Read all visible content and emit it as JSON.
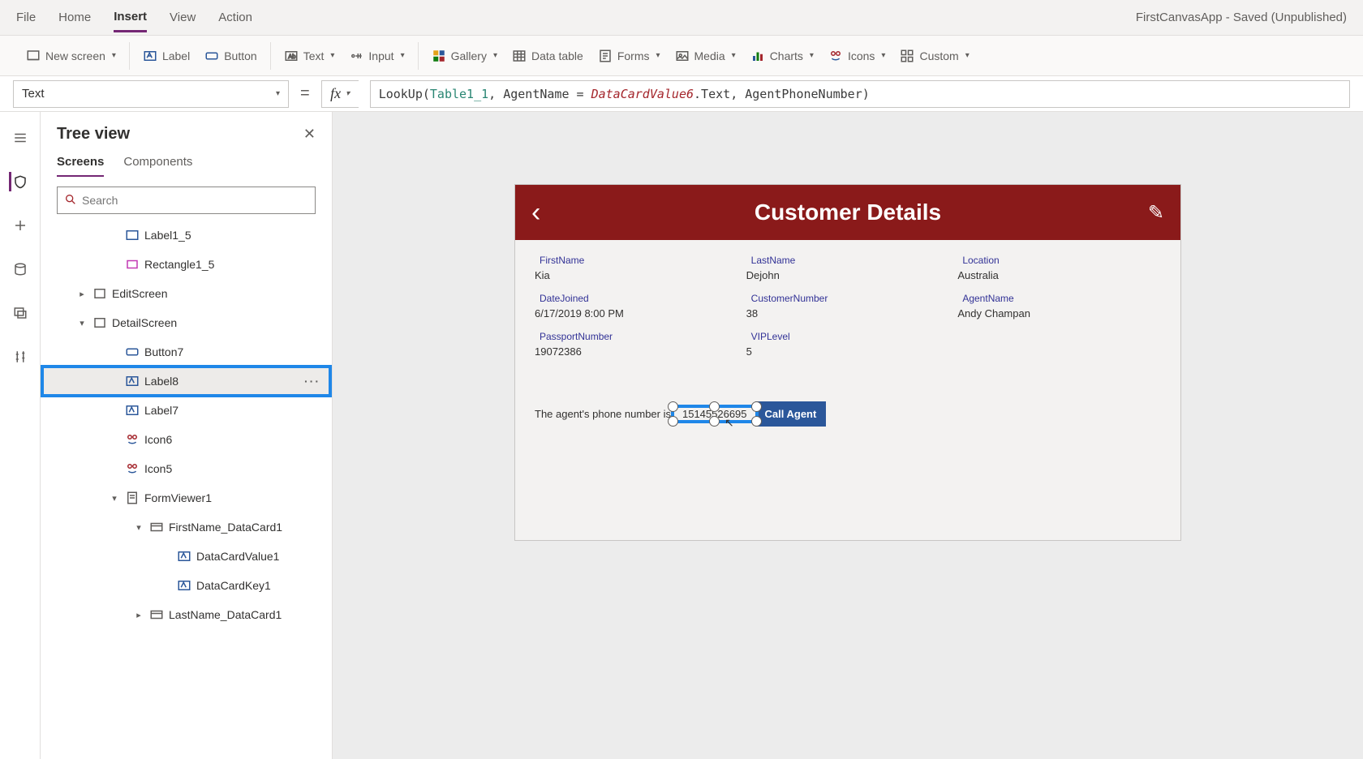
{
  "app_title": "FirstCanvasApp - Saved (Unpublished)",
  "menubar": [
    "File",
    "Home",
    "Insert",
    "View",
    "Action"
  ],
  "menubar_active": "Insert",
  "ribbon": {
    "new_screen": "New screen",
    "label": "Label",
    "button": "Button",
    "text": "Text",
    "input": "Input",
    "gallery": "Gallery",
    "data_table": "Data table",
    "forms": "Forms",
    "media": "Media",
    "charts": "Charts",
    "icons": "Icons",
    "custom": "Custom"
  },
  "formula": {
    "property": "Text",
    "fx": "fx",
    "tokens": {
      "fn": "LookUp",
      "arg1": "Table1_1",
      "arg2a": "AgentName",
      "arg2b": "DataCardValue6",
      "arg2c": ".Text",
      "arg3": "AgentPhoneNumber"
    }
  },
  "treeview": {
    "title": "Tree view",
    "tabs": [
      "Screens",
      "Components"
    ],
    "tabs_active": "Screens",
    "search_placeholder": "Search",
    "nodes": {
      "label1_5": "Label1_5",
      "rectangle1_5": "Rectangle1_5",
      "editscreen": "EditScreen",
      "detailscreen": "DetailScreen",
      "button7": "Button7",
      "label8": "Label8",
      "label7": "Label7",
      "icon6": "Icon6",
      "icon5": "Icon5",
      "formviewer1": "FormViewer1",
      "firstname_dc": "FirstName_DataCard1",
      "datacardvalue1": "DataCardValue1",
      "datacardkey1": "DataCardKey1",
      "lastname_dc": "LastName_DataCard1"
    }
  },
  "canvas": {
    "header_title": "Customer Details",
    "fields": {
      "firstname_l": "FirstName",
      "firstname_v": "Kia",
      "lastname_l": "LastName",
      "lastname_v": "Dejohn",
      "location_l": "Location",
      "location_v": "Australia",
      "datejoined_l": "DateJoined",
      "datejoined_v": "6/17/2019 8:00 PM",
      "custnum_l": "CustomerNumber",
      "custnum_v": "38",
      "agent_l": "AgentName",
      "agent_v": "Andy Champan",
      "passport_l": "PassportNumber",
      "passport_v": "19072386",
      "vip_l": "VIPLevel",
      "vip_v": "5"
    },
    "phone_label_prefix": "The agent's phone number is ",
    "phone_number": "15145526695",
    "call_button": "Call Agent"
  }
}
